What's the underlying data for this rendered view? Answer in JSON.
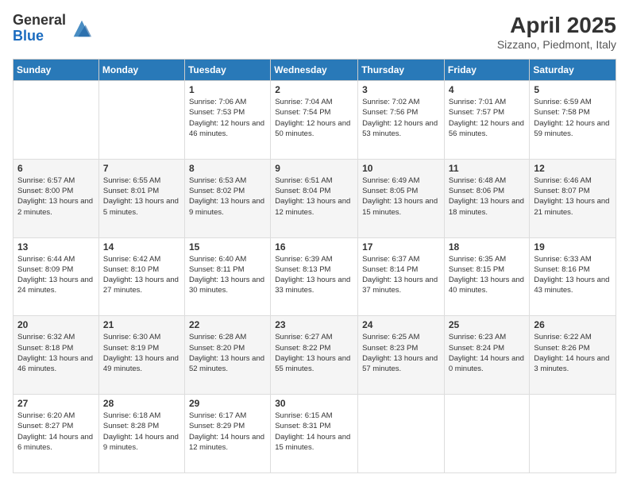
{
  "logo": {
    "general": "General",
    "blue": "Blue"
  },
  "header": {
    "title": "April 2025",
    "subtitle": "Sizzano, Piedmont, Italy"
  },
  "days_of_week": [
    "Sunday",
    "Monday",
    "Tuesday",
    "Wednesday",
    "Thursday",
    "Friday",
    "Saturday"
  ],
  "weeks": [
    [
      {
        "day": "",
        "sunrise": "",
        "sunset": "",
        "daylight": ""
      },
      {
        "day": "",
        "sunrise": "",
        "sunset": "",
        "daylight": ""
      },
      {
        "day": "1",
        "sunrise": "Sunrise: 7:06 AM",
        "sunset": "Sunset: 7:53 PM",
        "daylight": "Daylight: 12 hours and 46 minutes."
      },
      {
        "day": "2",
        "sunrise": "Sunrise: 7:04 AM",
        "sunset": "Sunset: 7:54 PM",
        "daylight": "Daylight: 12 hours and 50 minutes."
      },
      {
        "day": "3",
        "sunrise": "Sunrise: 7:02 AM",
        "sunset": "Sunset: 7:56 PM",
        "daylight": "Daylight: 12 hours and 53 minutes."
      },
      {
        "day": "4",
        "sunrise": "Sunrise: 7:01 AM",
        "sunset": "Sunset: 7:57 PM",
        "daylight": "Daylight: 12 hours and 56 minutes."
      },
      {
        "day": "5",
        "sunrise": "Sunrise: 6:59 AM",
        "sunset": "Sunset: 7:58 PM",
        "daylight": "Daylight: 12 hours and 59 minutes."
      }
    ],
    [
      {
        "day": "6",
        "sunrise": "Sunrise: 6:57 AM",
        "sunset": "Sunset: 8:00 PM",
        "daylight": "Daylight: 13 hours and 2 minutes."
      },
      {
        "day": "7",
        "sunrise": "Sunrise: 6:55 AM",
        "sunset": "Sunset: 8:01 PM",
        "daylight": "Daylight: 13 hours and 5 minutes."
      },
      {
        "day": "8",
        "sunrise": "Sunrise: 6:53 AM",
        "sunset": "Sunset: 8:02 PM",
        "daylight": "Daylight: 13 hours and 9 minutes."
      },
      {
        "day": "9",
        "sunrise": "Sunrise: 6:51 AM",
        "sunset": "Sunset: 8:04 PM",
        "daylight": "Daylight: 13 hours and 12 minutes."
      },
      {
        "day": "10",
        "sunrise": "Sunrise: 6:49 AM",
        "sunset": "Sunset: 8:05 PM",
        "daylight": "Daylight: 13 hours and 15 minutes."
      },
      {
        "day": "11",
        "sunrise": "Sunrise: 6:48 AM",
        "sunset": "Sunset: 8:06 PM",
        "daylight": "Daylight: 13 hours and 18 minutes."
      },
      {
        "day": "12",
        "sunrise": "Sunrise: 6:46 AM",
        "sunset": "Sunset: 8:07 PM",
        "daylight": "Daylight: 13 hours and 21 minutes."
      }
    ],
    [
      {
        "day": "13",
        "sunrise": "Sunrise: 6:44 AM",
        "sunset": "Sunset: 8:09 PM",
        "daylight": "Daylight: 13 hours and 24 minutes."
      },
      {
        "day": "14",
        "sunrise": "Sunrise: 6:42 AM",
        "sunset": "Sunset: 8:10 PM",
        "daylight": "Daylight: 13 hours and 27 minutes."
      },
      {
        "day": "15",
        "sunrise": "Sunrise: 6:40 AM",
        "sunset": "Sunset: 8:11 PM",
        "daylight": "Daylight: 13 hours and 30 minutes."
      },
      {
        "day": "16",
        "sunrise": "Sunrise: 6:39 AM",
        "sunset": "Sunset: 8:13 PM",
        "daylight": "Daylight: 13 hours and 33 minutes."
      },
      {
        "day": "17",
        "sunrise": "Sunrise: 6:37 AM",
        "sunset": "Sunset: 8:14 PM",
        "daylight": "Daylight: 13 hours and 37 minutes."
      },
      {
        "day": "18",
        "sunrise": "Sunrise: 6:35 AM",
        "sunset": "Sunset: 8:15 PM",
        "daylight": "Daylight: 13 hours and 40 minutes."
      },
      {
        "day": "19",
        "sunrise": "Sunrise: 6:33 AM",
        "sunset": "Sunset: 8:16 PM",
        "daylight": "Daylight: 13 hours and 43 minutes."
      }
    ],
    [
      {
        "day": "20",
        "sunrise": "Sunrise: 6:32 AM",
        "sunset": "Sunset: 8:18 PM",
        "daylight": "Daylight: 13 hours and 46 minutes."
      },
      {
        "day": "21",
        "sunrise": "Sunrise: 6:30 AM",
        "sunset": "Sunset: 8:19 PM",
        "daylight": "Daylight: 13 hours and 49 minutes."
      },
      {
        "day": "22",
        "sunrise": "Sunrise: 6:28 AM",
        "sunset": "Sunset: 8:20 PM",
        "daylight": "Daylight: 13 hours and 52 minutes."
      },
      {
        "day": "23",
        "sunrise": "Sunrise: 6:27 AM",
        "sunset": "Sunset: 8:22 PM",
        "daylight": "Daylight: 13 hours and 55 minutes."
      },
      {
        "day": "24",
        "sunrise": "Sunrise: 6:25 AM",
        "sunset": "Sunset: 8:23 PM",
        "daylight": "Daylight: 13 hours and 57 minutes."
      },
      {
        "day": "25",
        "sunrise": "Sunrise: 6:23 AM",
        "sunset": "Sunset: 8:24 PM",
        "daylight": "Daylight: 14 hours and 0 minutes."
      },
      {
        "day": "26",
        "sunrise": "Sunrise: 6:22 AM",
        "sunset": "Sunset: 8:26 PM",
        "daylight": "Daylight: 14 hours and 3 minutes."
      }
    ],
    [
      {
        "day": "27",
        "sunrise": "Sunrise: 6:20 AM",
        "sunset": "Sunset: 8:27 PM",
        "daylight": "Daylight: 14 hours and 6 minutes."
      },
      {
        "day": "28",
        "sunrise": "Sunrise: 6:18 AM",
        "sunset": "Sunset: 8:28 PM",
        "daylight": "Daylight: 14 hours and 9 minutes."
      },
      {
        "day": "29",
        "sunrise": "Sunrise: 6:17 AM",
        "sunset": "Sunset: 8:29 PM",
        "daylight": "Daylight: 14 hours and 12 minutes."
      },
      {
        "day": "30",
        "sunrise": "Sunrise: 6:15 AM",
        "sunset": "Sunset: 8:31 PM",
        "daylight": "Daylight: 14 hours and 15 minutes."
      },
      {
        "day": "",
        "sunrise": "",
        "sunset": "",
        "daylight": ""
      },
      {
        "day": "",
        "sunrise": "",
        "sunset": "",
        "daylight": ""
      },
      {
        "day": "",
        "sunrise": "",
        "sunset": "",
        "daylight": ""
      }
    ]
  ]
}
